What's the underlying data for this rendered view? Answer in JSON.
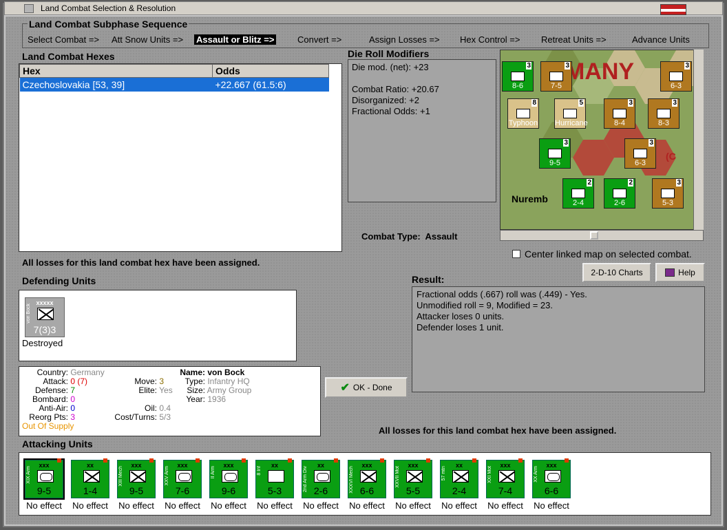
{
  "window": {
    "title": "Land Combat Selection & Resolution"
  },
  "subphase": {
    "heading": "Land Combat Subphase Sequence",
    "steps": [
      "Select Combat =>",
      "Att Snow Units =>",
      "Assault or Blitz =>",
      "Convert =>",
      "Assign Losses =>",
      "Hex Control =>",
      "Retreat Units =>",
      "Advance Units"
    ],
    "active_index": 2
  },
  "hexes": {
    "heading": "Land Combat Hexes",
    "columns": [
      "Hex",
      "Odds"
    ],
    "rows": [
      {
        "hex": "Czechoslovakia [53, 39]",
        "odds": "+22.667 (61.5:6)"
      }
    ]
  },
  "modifiers": {
    "heading": "Die Roll Modifiers",
    "lines": [
      "Die mod. (net): +23",
      "",
      "Combat Ratio: +20.67",
      "Disorganized: +2",
      "Fractional Odds: +1"
    ]
  },
  "combat_type": {
    "label": "Combat Type:",
    "value": "Assault"
  },
  "center_map": {
    "label": "Center linked map on selected combat.",
    "checked": false
  },
  "buttons": {
    "charts": "2-D-10 Charts",
    "help": "Help",
    "ok": "OK - Done"
  },
  "losses_msg": "All losses for this land combat hex have been assigned.",
  "defending": {
    "heading": "Defending Units",
    "unit": {
      "size": "xxxxx",
      "side_text": "von Bock",
      "strength": "7(3)3",
      "status": "Destroyed"
    }
  },
  "result": {
    "heading": "Result:",
    "lines": [
      "Fractional odds (.667) roll was (.449)  - Yes.",
      "Unmodified roll = 9, Modified = 23.",
      "Attacker loses 0 units.",
      "Defender loses 1 unit."
    ]
  },
  "details": {
    "country": {
      "k": "Country:",
      "v": "Germany"
    },
    "attack": {
      "k": "Attack:",
      "v": "0",
      "v2": "(7)"
    },
    "defense": {
      "k": "Defense:",
      "v": "7"
    },
    "bombard": {
      "k": "Bombard:",
      "v": "0"
    },
    "antiair": {
      "k": "Anti-Air:",
      "v": "0"
    },
    "reorg": {
      "k": "Reorg Pts:",
      "v": "3"
    },
    "supply": "Out Of Supply",
    "move": {
      "k": "Move:",
      "v": "3"
    },
    "elite": {
      "k": "Elite:",
      "v": "Yes"
    },
    "oil": {
      "k": "Oil:",
      "v": "0.4"
    },
    "cost": {
      "k": "Cost/Turns:",
      "v": "5/3"
    },
    "name": {
      "k": "Name:",
      "v": "von Bock"
    },
    "type": {
      "k": "Type:",
      "v": "Infantry HQ"
    },
    "size": {
      "k": "Size:",
      "v": "Army Group"
    },
    "year": {
      "k": "Year:",
      "v": "1936"
    }
  },
  "attacking": {
    "heading": "Attacking Units",
    "units": [
      {
        "size": "xxx",
        "side": "XIX Arm",
        "str": "9-5",
        "sym": "oval",
        "result": "No effect"
      },
      {
        "size": "xx",
        "side": "",
        "str": "1-4",
        "sym": "x",
        "result": "No effect"
      },
      {
        "size": "xxx",
        "side": "XIII Mech",
        "str": "9-5",
        "sym": "x",
        "result": "No effect"
      },
      {
        "size": "xxx",
        "side": "XXV Arm",
        "str": "7-6",
        "sym": "oval",
        "result": "No effect"
      },
      {
        "size": "xxx",
        "side": "II Arm",
        "str": "9-6",
        "sym": "oval",
        "result": "No effect"
      },
      {
        "size": "xx",
        "side": "8 Inf",
        "str": "5-3",
        "sym": "dot",
        "result": "No effect"
      },
      {
        "size": "xx",
        "side": "2nd Arm Div",
        "str": "2-6",
        "sym": "oval",
        "result": "No effect"
      },
      {
        "size": "xxx",
        "side": "XXXVI Mech",
        "str": "6-6",
        "sym": "x",
        "result": "No effect"
      },
      {
        "size": "xxx",
        "side": "XXVII Mot",
        "str": "5-5",
        "sym": "x",
        "result": "No effect"
      },
      {
        "size": "xx",
        "side": "57 mtn",
        "str": "2-4",
        "sym": "x",
        "result": "No effect"
      },
      {
        "size": "xxx",
        "side": "XXI Mot",
        "str": "7-4",
        "sym": "x",
        "result": "No effect"
      },
      {
        "size": "xxx",
        "side": "XX Arm",
        "str": "6-6",
        "sym": "oval",
        "result": "No effect"
      }
    ]
  },
  "map": {
    "labels": [
      "MANY",
      "Nuremb",
      "(C"
    ],
    "counters": [
      {
        "top": "3",
        "label": "8-6",
        "color": "#0a9e12"
      },
      {
        "top": "3",
        "label": "7-5",
        "color": "#b07820"
      },
      {
        "top": "3",
        "label": "6-3",
        "color": "#b07820"
      },
      {
        "top": "8",
        "label": "Typhoon",
        "color": "#d9c28a"
      },
      {
        "top": "5",
        "label": "Hurricane",
        "color": "#d9c28a"
      },
      {
        "top": "3",
        "label": "8-4",
        "color": "#b07820"
      },
      {
        "top": "3",
        "label": "8-3",
        "color": "#b07820"
      },
      {
        "top": "3",
        "label": "9-5",
        "color": "#0a9e12"
      },
      {
        "top": "3",
        "label": "6-3",
        "color": "#b07820"
      },
      {
        "top": "2",
        "label": "2-4",
        "color": "#0a9e12"
      },
      {
        "top": "2",
        "label": "2-6",
        "color": "#0a9e12"
      },
      {
        "top": "3",
        "label": "5-3",
        "color": "#b07820"
      }
    ]
  }
}
